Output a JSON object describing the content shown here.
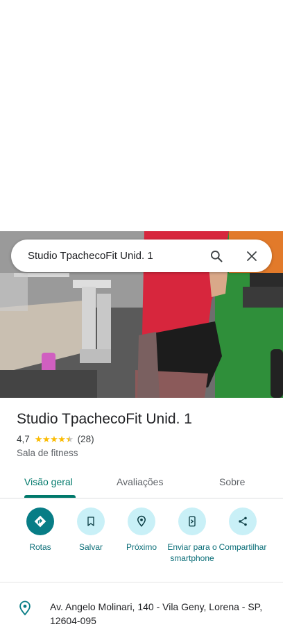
{
  "search": {
    "query": "Studio TpachecoFit Unid. 1"
  },
  "place": {
    "name": "Studio TpachecoFit Unid. 1",
    "rating": "4,7",
    "stars": 4.7,
    "review_count": "(28)",
    "category": "Sala de fitness"
  },
  "tabs": [
    {
      "label": "Visão geral",
      "active": true
    },
    {
      "label": "Avaliações",
      "active": false
    },
    {
      "label": "Sobre",
      "active": false
    }
  ],
  "actions": [
    {
      "label": "Rotas",
      "icon": "directions-icon"
    },
    {
      "label": "Salvar",
      "icon": "bookmark-icon"
    },
    {
      "label": "Próximo",
      "icon": "nearby-icon"
    },
    {
      "label": "Enviar para o smartphone",
      "icon": "send-to-phone-icon"
    },
    {
      "label": "Compartilhar",
      "icon": "share-icon"
    }
  ],
  "address": {
    "text": "Av. Angelo Molinari, 140 - Vila Geny, Lorena - SP, 12604-095",
    "icon": "location-pin-icon"
  },
  "colors": {
    "accent": "#00796b",
    "action_bg": "#c9f0f7",
    "primary_action_bg": "#087d86",
    "star": "#fbbc04"
  }
}
